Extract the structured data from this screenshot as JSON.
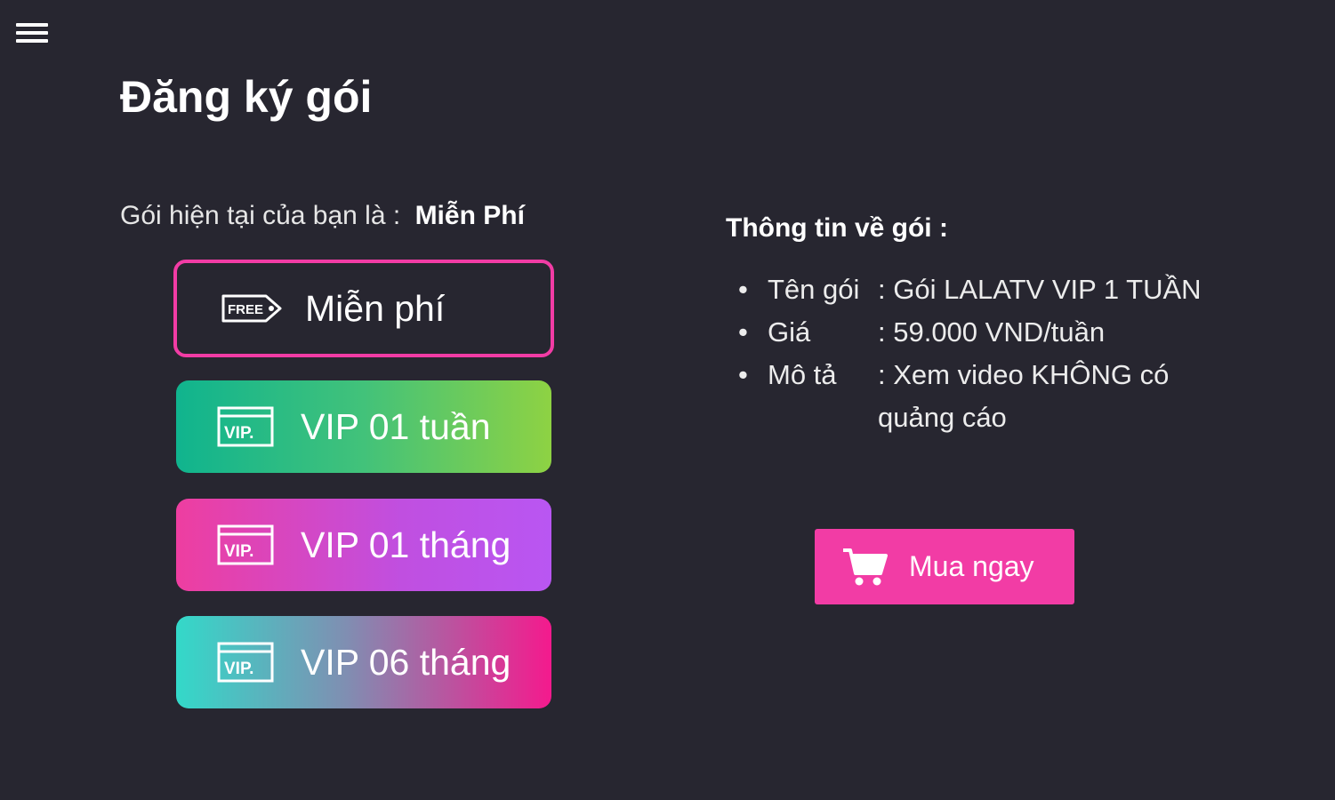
{
  "header": {
    "menu_icon": "hamburger-menu-icon",
    "title": "Đăng ký gói"
  },
  "current_plan": {
    "label": "Gói hiện tại của bạn là :",
    "value": "Miễn Phí"
  },
  "plans": [
    {
      "label": "Miễn phí",
      "icon": "free-tag-icon",
      "badge": "FREE",
      "selected": true
    },
    {
      "label": "VIP 01 tuần",
      "icon": "vip-ticket-icon",
      "badge": "VIP."
    },
    {
      "label": "VIP 01 tháng",
      "icon": "vip-ticket-icon",
      "badge": "VIP."
    },
    {
      "label": "VIP 06 tháng",
      "icon": "vip-ticket-icon",
      "badge": "VIP."
    }
  ],
  "info": {
    "title": "Thông tin về gói :",
    "rows": [
      {
        "key": "Tên gói",
        "value": ": Gói LALATV VIP 1 TUẦN"
      },
      {
        "key": "Giá",
        "value": ": 59.000 VND/tuần"
      },
      {
        "key": "Mô tả",
        "value": ": Xem video KHÔNG có quảng cáo"
      }
    ]
  },
  "buy_button": {
    "label": "Mua ngay",
    "icon": "shopping-cart-icon"
  },
  "colors": {
    "background": "#272630",
    "accent": "#f23ca5"
  }
}
